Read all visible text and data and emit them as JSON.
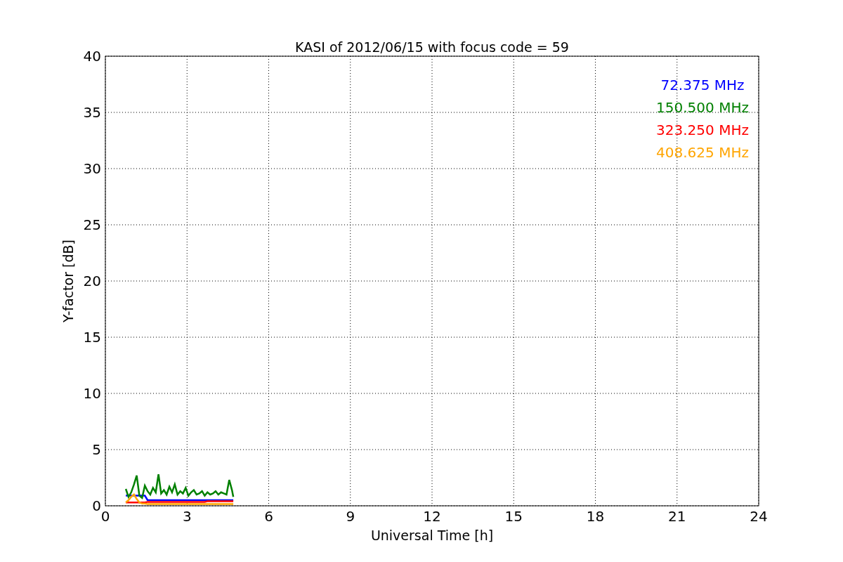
{
  "chart_data": {
    "type": "line",
    "title": "KASI of 2012/06/15 with focus code = 59",
    "xlabel": "Universal Time [h]",
    "ylabel": "Y-factor [dB]",
    "x": [
      0.75,
      0.85,
      0.95,
      1.05,
      1.15,
      1.25,
      1.35,
      1.45,
      1.55,
      1.65,
      1.75,
      1.85,
      1.95,
      2.05,
      2.15,
      2.25,
      2.35,
      2.45,
      2.55,
      2.65,
      2.75,
      2.85,
      2.95,
      3.05,
      3.15,
      3.25,
      3.35,
      3.45,
      3.55,
      3.65,
      3.75,
      3.85,
      3.95,
      4.05,
      4.15,
      4.25,
      4.35,
      4.45,
      4.55,
      4.65,
      4.7
    ],
    "series": [
      {
        "name": "72.375 MHz",
        "color": "#0000ff",
        "values": [
          0.9,
          0.9,
          0.9,
          0.9,
          0.9,
          0.9,
          0.9,
          0.9,
          0.5,
          0.5,
          0.5,
          0.5,
          0.5,
          0.5,
          0.5,
          0.5,
          0.5,
          0.5,
          0.5,
          0.5,
          0.5,
          0.5,
          0.5,
          0.5,
          0.5,
          0.5,
          0.5,
          0.5,
          0.5,
          0.5,
          0.5,
          0.5,
          0.5,
          0.5,
          0.5,
          0.5,
          0.5,
          0.5,
          0.5,
          0.5,
          0.5
        ]
      },
      {
        "name": "150.500 MHz",
        "color": "#008000",
        "values": [
          1.5,
          0.8,
          1.2,
          1.9,
          2.7,
          0.9,
          0.7,
          1.8,
          1.3,
          1.0,
          1.6,
          1.2,
          2.8,
          1.1,
          1.4,
          1.0,
          1.7,
          1.2,
          1.9,
          1.0,
          1.3,
          1.1,
          1.6,
          0.9,
          1.2,
          1.4,
          1.0,
          1.1,
          1.3,
          0.9,
          1.2,
          1.0,
          1.1,
          1.3,
          1.0,
          1.2,
          1.1,
          1.0,
          2.3,
          1.4,
          0.8
        ]
      },
      {
        "name": "323.250 MHz",
        "color": "#ff0000",
        "values": [
          0.3,
          0.3,
          0.3,
          0.3,
          0.3,
          0.3,
          0.3,
          0.3,
          0.35,
          0.35,
          0.35,
          0.35,
          0.35,
          0.35,
          0.35,
          0.35,
          0.35,
          0.35,
          0.35,
          0.35,
          0.35,
          0.35,
          0.35,
          0.35,
          0.35,
          0.35,
          0.35,
          0.35,
          0.35,
          0.35,
          0.4,
          0.4,
          0.4,
          0.4,
          0.4,
          0.4,
          0.4,
          0.4,
          0.4,
          0.4,
          0.4
        ]
      },
      {
        "name": "408.625 MHz",
        "color": "#ffa500",
        "values": [
          0.3,
          0.5,
          0.8,
          1.0,
          0.6,
          0.3,
          0.2,
          0.2,
          0.15,
          0.15,
          0.15,
          0.15,
          0.15,
          0.15,
          0.15,
          0.15,
          0.15,
          0.15,
          0.15,
          0.15,
          0.15,
          0.15,
          0.15,
          0.15,
          0.15,
          0.15,
          0.15,
          0.15,
          0.15,
          0.15,
          0.15,
          0.15,
          0.15,
          0.15,
          0.15,
          0.15,
          0.15,
          0.15,
          0.15,
          0.15,
          0.15
        ]
      }
    ],
    "grid": true,
    "xlim": [
      0,
      24
    ],
    "ylim": [
      0,
      40
    ],
    "xticks": [
      0,
      3,
      6,
      9,
      12,
      15,
      18,
      21,
      24
    ],
    "yticks": [
      0,
      5,
      10,
      15,
      20,
      25,
      30,
      35,
      40
    ]
  }
}
